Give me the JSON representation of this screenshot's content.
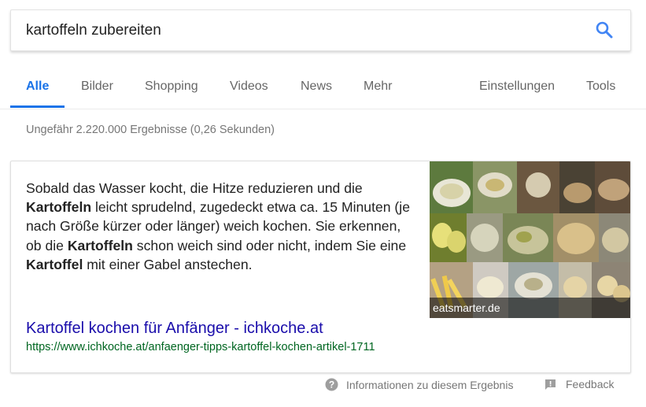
{
  "search": {
    "query": "kartoffeln zubereiten"
  },
  "tabs": [
    {
      "label": "Alle",
      "active": true
    },
    {
      "label": "Bilder"
    },
    {
      "label": "Shopping"
    },
    {
      "label": "Videos"
    },
    {
      "label": "News"
    },
    {
      "label": "Mehr"
    }
  ],
  "tools": {
    "settings_label": "Einstellungen",
    "tools_label": "Tools"
  },
  "result_stats": "Ungefähr 2.220.000 Ergebnisse (0,26 Sekunden)",
  "featured_snippet": {
    "text_parts": [
      "Sobald das Wasser kocht, die Hitze reduzieren und die ",
      "Kartoffeln",
      " leicht sprudelnd, zugedeckt etwa ca. 15 Minuten (je nach Größe kürzer oder länger) weich kochen. Sie erkennen, ob die ",
      "Kartoffeln",
      " schon weich sind oder nicht, indem Sie eine ",
      "Kartoffel",
      " mit einer Gabel anstechen."
    ],
    "image_caption": "eatsmarter.de",
    "title": "Kartoffel kochen für Anfänger - ichkoche.at",
    "url": "https://www.ichkoche.at/anfaenger-tipps-kartoffel-kochen-artikel-1711"
  },
  "footer": {
    "info_label": "Informationen zu diesem Ergebnis",
    "feedback_label": "Feedback"
  },
  "colors": {
    "accent": "#1a73e8",
    "link": "#1a0dab",
    "url": "#006621"
  },
  "icons": [
    "search-icon",
    "help-icon",
    "feedback-icon"
  ]
}
